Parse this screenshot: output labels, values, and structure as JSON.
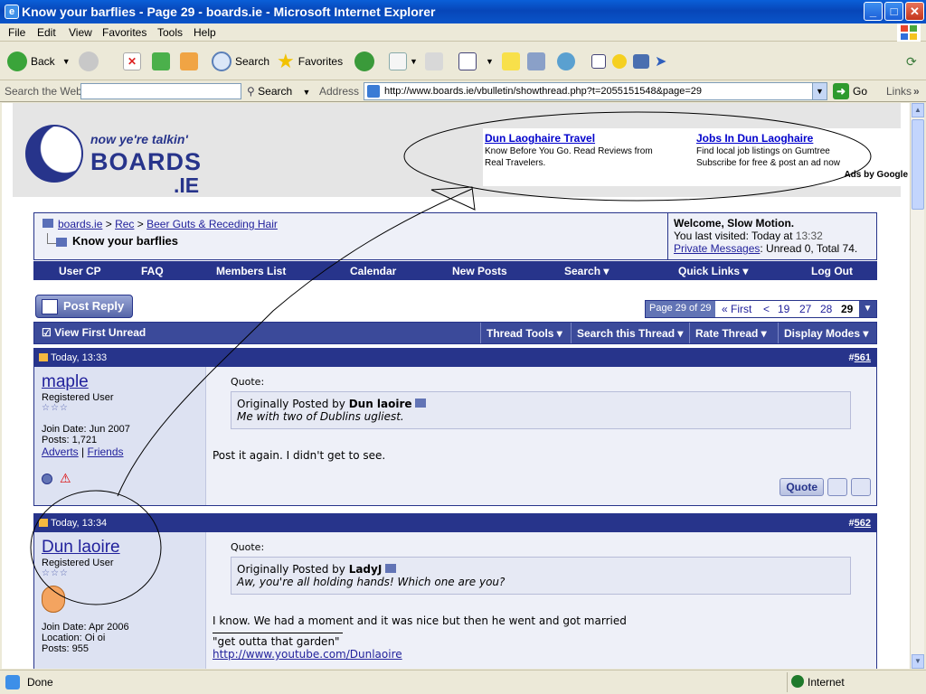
{
  "window": {
    "title": "Know your barflies - Page 29 - boards.ie - Microsoft Internet Explorer",
    "controls": [
      "_",
      "□",
      "✕"
    ]
  },
  "menu": [
    "File",
    "Edit",
    "View",
    "Favorites",
    "Tools",
    "Help"
  ],
  "toolbar": {
    "back": "Back",
    "search": "Search",
    "favorites": "Favorites"
  },
  "addressbar": {
    "search_label": "Search the Web",
    "search_button": "Search",
    "address_label": "Address",
    "url": "http://www.boards.ie/vbulletin/showthread.php?t=2055151548&page=29",
    "go": "Go",
    "links": "Links"
  },
  "header": {
    "tagline": "now ye're talkin'",
    "brand_line1": "BOARDS",
    "brand_line2": ".IE"
  },
  "ads": {
    "ad1_title": "Dun Laoghaire Travel",
    "ad1_line1": "Know Before You Go. Read Reviews from",
    "ad1_line2": "Real Travelers.",
    "ad2_title": "Jobs In Dun Laoghaire",
    "ad2_line1": "Find local job listings on Gumtree",
    "ad2_line2": "Subscribe for free & post an ad now",
    "ads_by": "Ads by Google"
  },
  "breadcrumb": {
    "site": "boards.ie",
    "sep1": ">",
    "forum": "Rec",
    "sep2": ">",
    "subforum": "Beer Guts & Receding Hair",
    "thread": "Know your barflies"
  },
  "welcome": {
    "greeting": "Welcome, Slow Motion.",
    "last_visit_label": "You last visited: Today at",
    "last_visit_time": "13:32",
    "pm_link": "Private Messages",
    "pm_text": ": Unread 0, Total 74."
  },
  "navbar": [
    "User CP",
    "FAQ",
    "Members List",
    "Calendar",
    "New Posts",
    "Search ▾",
    "Quick Links ▾",
    "Log Out"
  ],
  "post_reply": "Post Reply",
  "pager": {
    "label": "Page 29 of 29",
    "first": "« First",
    "prev": "<",
    "pages": [
      "19",
      "27",
      "28"
    ],
    "current": "29",
    "dropdown": "▼"
  },
  "threadbar": {
    "view_first_unread": "View First Unread",
    "tools": "Thread Tools ▾",
    "search": "Search this Thread ▾",
    "rate": "Rate Thread ▾",
    "display": "Display Modes ▾"
  },
  "posts": [
    {
      "time": "Today, 13:33",
      "number_prefix": "#",
      "number": "561",
      "username": "maple",
      "rank": "Registered User",
      "stars": "☆☆☆",
      "join": "Join Date: Jun 2007",
      "posts": "Posts: 1,721",
      "link1": "Adverts",
      "sep": "|",
      "link2": "Friends",
      "quote_label": "Quote:",
      "quote_by_prefix": "Originally Posted by",
      "quote_author": "Dun laoire",
      "quote_text": "Me with two of Dublins ugliest.",
      "text": "Post it again. I didn't get to see.",
      "quote_button": "Quote"
    },
    {
      "time": "Today, 13:34",
      "number_prefix": "#",
      "number": "562",
      "username": "Dun laoire",
      "rank": "Registered User",
      "stars": "☆☆☆",
      "join": "Join Date: Apr 2006",
      "location": "Location: Oi oi",
      "posts": "Posts: 955",
      "quote_label": "Quote:",
      "quote_by_prefix": "Originally Posted by",
      "quote_author": "LadyJ",
      "quote_text": "Aw, you're all holding hands! Which one are you?",
      "text": "I know. We had a moment and it was nice but then he went and got married",
      "sig_text": "\"get outta that garden\"",
      "sig_link": "http://www.youtube.com/Dunlaoire"
    }
  ],
  "status": {
    "left": "Done",
    "zone": "Internet"
  }
}
